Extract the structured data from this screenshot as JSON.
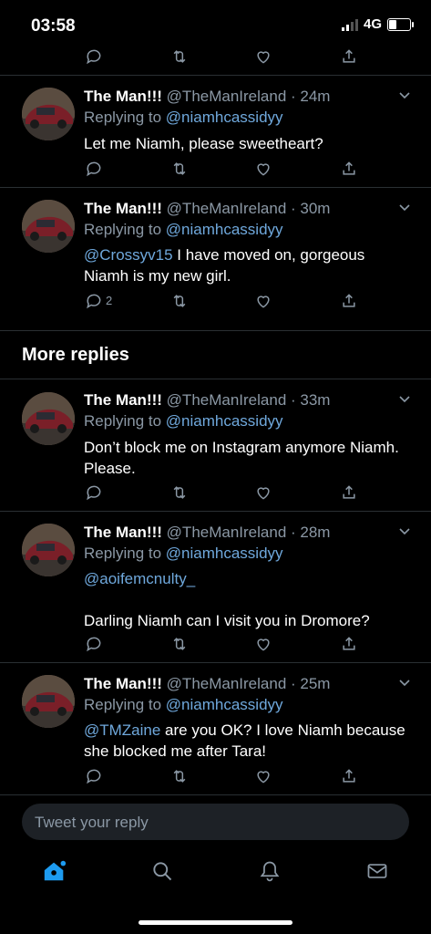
{
  "status_bar": {
    "time": "03:58",
    "network": "4G"
  },
  "colors": {
    "accent": "#1d9bf0",
    "mention": "#6fa8dc",
    "muted": "#8b98a5",
    "background": "#000000"
  },
  "tweets": [
    {
      "name": "The Man!!!",
      "handle": "@TheManIreland",
      "time": "· 24m",
      "replying_prefix": "Replying to",
      "replying_to": "@niamhcassidyy",
      "mention": "",
      "text": "Let me Niamh, please sweetheart?",
      "reply_count": ""
    },
    {
      "name": "The Man!!!",
      "handle": "@TheManIreland",
      "time": "· 30m",
      "replying_prefix": "Replying to",
      "replying_to": "@niamhcassidyy",
      "mention": "@Crossyv15",
      "text": " I have moved on, gorgeous Niamh is my new girl.",
      "reply_count": "2"
    },
    {
      "name": "The Man!!!",
      "handle": "@TheManIreland",
      "time": "· 33m",
      "replying_prefix": "Replying to",
      "replying_to": "@niamhcassidyy",
      "mention": "",
      "text": "Don’t block me on Instagram anymore Niamh. Please.",
      "reply_count": ""
    },
    {
      "name": "The Man!!!",
      "handle": "@TheManIreland",
      "time": "· 28m",
      "replying_prefix": "Replying to",
      "replying_to": "@niamhcassidyy",
      "mention": "@aoifemcnulty_",
      "text": "Darling Niamh can I visit you in Dromore?",
      "reply_count": ""
    },
    {
      "name": "The Man!!!",
      "handle": "@TheManIreland",
      "time": "· 25m",
      "replying_prefix": "Replying to",
      "replying_to": "@niamhcassidyy",
      "mention": "@TMZaine",
      "text": " are you OK? I love Niamh because she blocked me after Tara!",
      "reply_count": ""
    }
  ],
  "section": {
    "more_replies": "More replies"
  },
  "composer": {
    "placeholder": "Tweet your reply"
  },
  "tabs": [
    "home-icon",
    "search-icon",
    "notifications-icon",
    "messages-icon"
  ]
}
